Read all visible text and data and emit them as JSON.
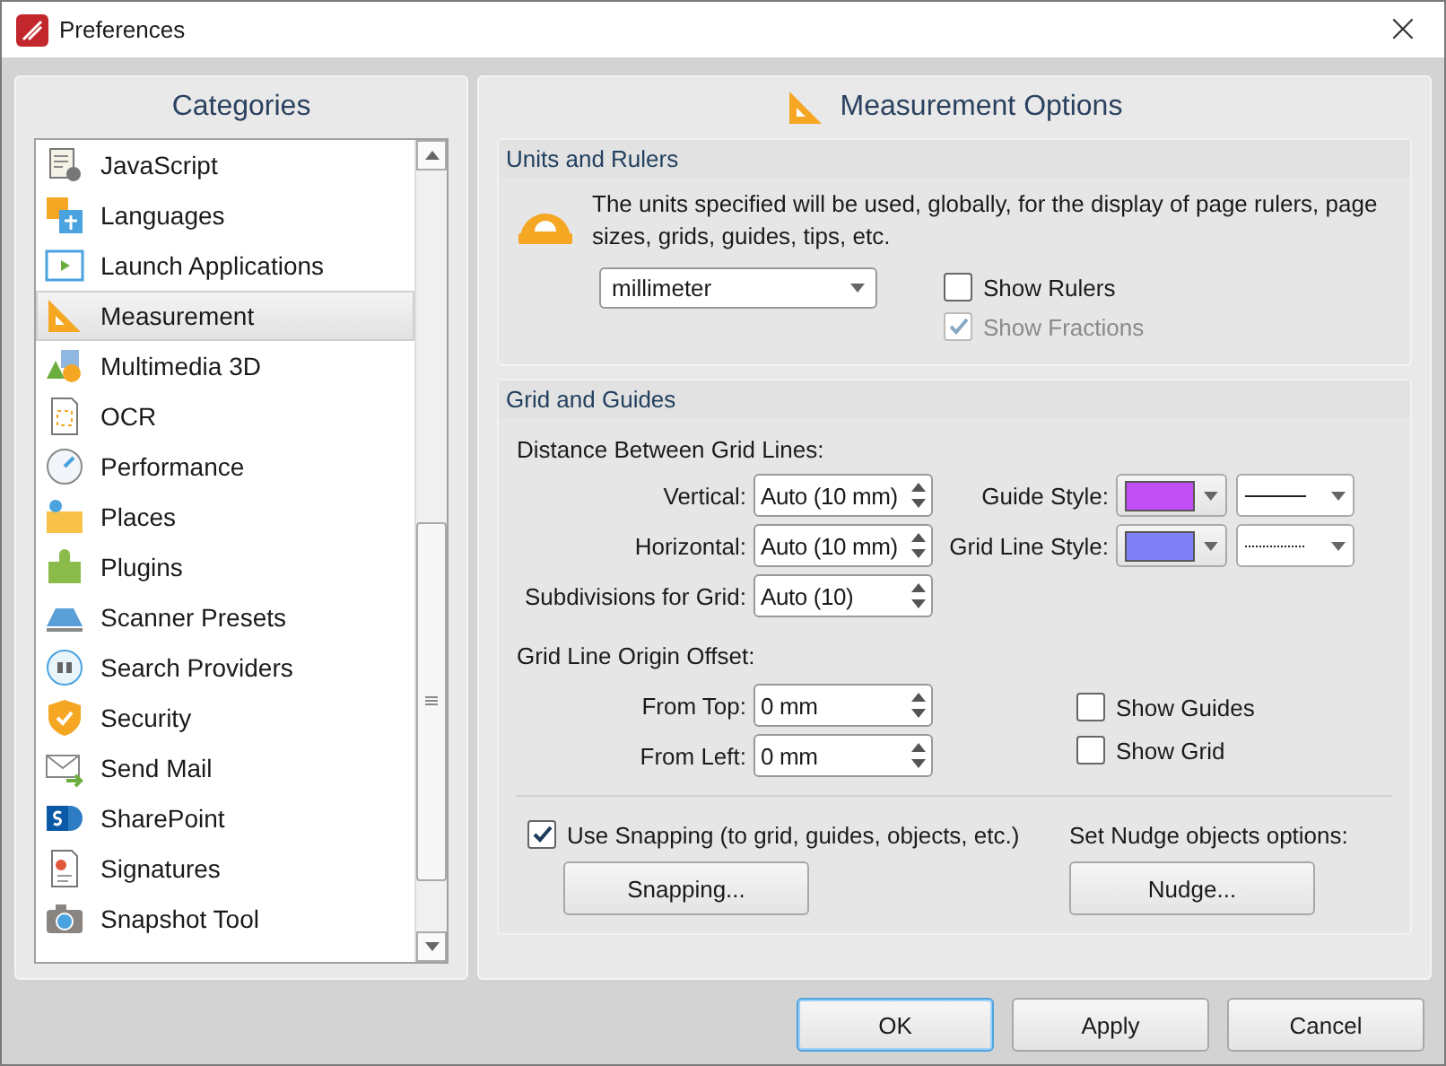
{
  "window": {
    "title": "Preferences",
    "close": "×"
  },
  "categories": {
    "title": "Categories",
    "items": [
      {
        "label": "JavaScript",
        "selected": false
      },
      {
        "label": "Languages",
        "selected": false
      },
      {
        "label": "Launch Applications",
        "selected": false
      },
      {
        "label": "Measurement",
        "selected": true
      },
      {
        "label": "Multimedia 3D",
        "selected": false
      },
      {
        "label": "OCR",
        "selected": false
      },
      {
        "label": "Performance",
        "selected": false
      },
      {
        "label": "Places",
        "selected": false
      },
      {
        "label": "Plugins",
        "selected": false
      },
      {
        "label": "Scanner Presets",
        "selected": false
      },
      {
        "label": "Search Providers",
        "selected": false
      },
      {
        "label": "Security",
        "selected": false
      },
      {
        "label": "Send Mail",
        "selected": false
      },
      {
        "label": "SharePoint",
        "selected": false
      },
      {
        "label": "Signatures",
        "selected": false
      },
      {
        "label": "Snapshot Tool",
        "selected": false
      }
    ]
  },
  "page": {
    "title": "Measurement Options",
    "units": {
      "title": "Units and Rulers",
      "description": "The units specified will be used, globally, for the display of page rulers, page sizes, grids, guides, tips, etc.",
      "unit": "millimeter",
      "checks": [
        {
          "label": "Show Rulers",
          "checked": false,
          "disabled": false
        },
        {
          "label": "Show Fractions",
          "checked": true,
          "disabled": true
        }
      ]
    },
    "grid": {
      "title": "Grid and Guides",
      "distance_heading": "Distance Between Grid Lines:",
      "distance_fields": [
        {
          "label": "Vertical:",
          "value": "Auto (10 mm)"
        },
        {
          "label": "Horizontal:",
          "value": "Auto (10 mm)"
        },
        {
          "label": "Subdivisions for Grid:",
          "value": "Auto (10)"
        }
      ],
      "styles": [
        {
          "label": "Guide Style:",
          "color": "#c14ff5",
          "kind": "solid"
        },
        {
          "label": "Grid Line Style:",
          "color": "#8080f8",
          "kind": "dotted"
        }
      ],
      "offset_heading": "Grid Line Origin Offset:",
      "offset_fields": [
        {
          "label": "From Top:",
          "value": "0 mm"
        },
        {
          "label": "From Left:",
          "value": "0 mm"
        }
      ],
      "show_checks": [
        {
          "label": "Show Guides",
          "checked": false
        },
        {
          "label": "Show Grid",
          "checked": false
        }
      ],
      "snapping": {
        "label": "Use Snapping (to grid, guides, objects, etc.)",
        "checked": true,
        "button": "Snapping..."
      },
      "nudge": {
        "label": "Set Nudge objects options:",
        "button": "Nudge..."
      }
    }
  },
  "buttons": [
    {
      "label": "OK",
      "default": true
    },
    {
      "label": "Apply",
      "default": false
    },
    {
      "label": "Cancel",
      "default": false
    }
  ]
}
